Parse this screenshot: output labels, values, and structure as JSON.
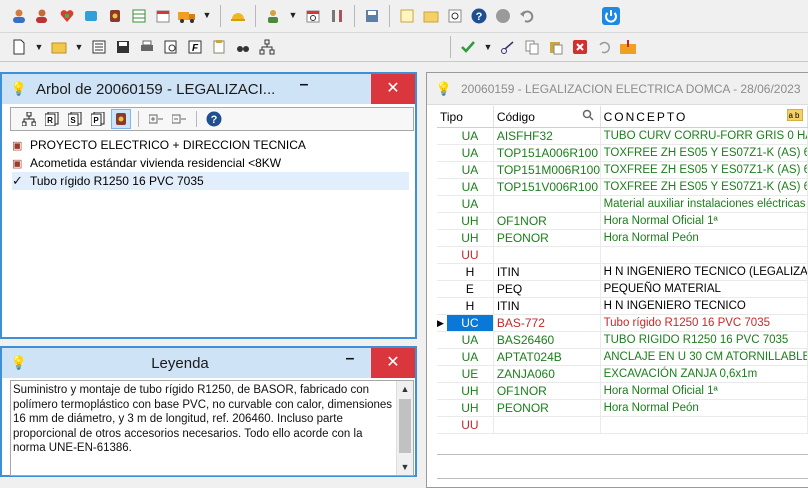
{
  "toolbar1": {
    "icons": [
      "user-icon",
      "user-edit-icon",
      "heart-icon",
      "puzzle-icon",
      "shield-icon",
      "table-icon",
      "calendar-icon",
      "truck-icon",
      "helmet-icon",
      "worker-icon",
      "calendar-clock-icon",
      "tools-icon",
      "save-disk-icon",
      "note-icon",
      "folder-open-icon",
      "clock-refresh-icon",
      "help-icon",
      "stop-icon",
      "undo-icon",
      "power-icon"
    ]
  },
  "toolbar2": {
    "icons": [
      "new-document-icon",
      "open-folder-icon",
      "list-icon",
      "save-icon",
      "print-icon",
      "print-preview-icon",
      "f-icon",
      "clipboard-icon",
      "binoculars-icon",
      "hierarchy-icon",
      "check-icon",
      "cut-icon",
      "copy-icon",
      "paste-icon",
      "delete-icon",
      "redo-icon",
      "export-icon"
    ]
  },
  "tree_panel": {
    "title": "Arbol de 20060159 - LEGALIZACI...",
    "minimize": "–",
    "close": "✕",
    "items": [
      {
        "label": "PROYECTO ELECTRICO + DIRECCION TECNICA",
        "icon": "folder-icon",
        "selected": false
      },
      {
        "label": "Acometida estándar vivienda residencial <8KW",
        "icon": "folder-icon",
        "selected": false
      },
      {
        "label": "Tubo rígido R1250 16 PVC 7035",
        "icon": "check-icon",
        "selected": true
      }
    ]
  },
  "legend_panel": {
    "title": "Leyenda",
    "minimize": "–",
    "close": "✕",
    "text": "Suministro y montaje de tubo rígido R1250, de BASOR, fabricado con polímero termoplástico con base PVC, no curvable con calor, dimensiones 16 mm de diámetro, y 3 m de longitud, ref. 206460. Incluso parte proporcional de otros accesorios necesarios. Todo ello acorde con la norma UNE-EN-61386."
  },
  "grid_panel": {
    "title": "20060159 - LEGALIZACION ELECTRICA DOMCA - 28/06/2023",
    "headers": {
      "tipo": "Tipo",
      "codigo": "Código",
      "concepto": "CONCEPTO"
    },
    "rows": [
      {
        "tipo": "UA",
        "codigo": "AISFHF32",
        "concepto": "TUBO CURV CORRU-FORR GRIS 0 HAL",
        "color": "#1a7f1a",
        "current": false
      },
      {
        "tipo": "UA",
        "codigo": "TOP151A006R100",
        "concepto": "TOXFREE ZH ES05 Y ES07Z1-K (AS) 6 A",
        "color": "#1a7f1a",
        "current": false
      },
      {
        "tipo": "UA",
        "codigo": "TOP151M006R100",
        "concepto": "TOXFREE ZH ES05 Y ES07Z1-K (AS) 6 M",
        "color": "#1a7f1a",
        "current": false
      },
      {
        "tipo": "UA",
        "codigo": "TOP151V006R100",
        "concepto": "TOXFREE ZH ES05 Y ES07Z1-K (AS) 6 A",
        "color": "#1a7f1a",
        "current": false
      },
      {
        "tipo": "UA",
        "codigo": "",
        "concepto": "Material auxiliar instalaciones eléctricas",
        "color": "#1a7f1a",
        "current": false
      },
      {
        "tipo": "UH",
        "codigo": "OF1NOR",
        "concepto": "Hora Normal Oficial 1ª",
        "color": "#1a7f1a",
        "current": false
      },
      {
        "tipo": "UH",
        "codigo": "PEONOR",
        "concepto": "Hora Normal Peón",
        "color": "#1a7f1a",
        "current": false
      },
      {
        "tipo": "UU",
        "codigo": "",
        "concepto": "",
        "color": "#c62828",
        "current": false
      },
      {
        "tipo": "H",
        "codigo": "ITIN",
        "concepto": "H N INGENIERO TECNICO (LEGALIZACI",
        "color": "#000000",
        "current": false
      },
      {
        "tipo": "E",
        "codigo": "PEQ",
        "concepto": "PEQUEÑO MATERIAL",
        "color": "#000000",
        "current": false
      },
      {
        "tipo": "H",
        "codigo": "ITIN",
        "concepto": "H N INGENIERO TECNICO",
        "color": "#000000",
        "current": false
      },
      {
        "tipo": "UC",
        "codigo": "BAS-772",
        "concepto": "Tubo rígido R1250 16 PVC 7035",
        "color": "#c62828",
        "current": true
      },
      {
        "tipo": "UA",
        "codigo": "BAS26460",
        "concepto": "TUBO RIGIDO R1250 16 PVC 7035",
        "color": "#1a7f1a",
        "current": false
      },
      {
        "tipo": "UA",
        "codigo": "APTAT024B",
        "concepto": "ANCLAJE EN U 30 CM ATORNILLABLE (",
        "color": "#1a7f1a",
        "current": false
      },
      {
        "tipo": "UE",
        "codigo": "ZANJA060",
        "concepto": "EXCAVACIÓN ZANJA 0,6x1m",
        "color": "#1a7f1a",
        "current": false
      },
      {
        "tipo": "UH",
        "codigo": "OF1NOR",
        "concepto": "Hora Normal Oficial 1ª",
        "color": "#1a7f1a",
        "current": false
      },
      {
        "tipo": "UH",
        "codigo": "PEONOR",
        "concepto": "Hora Normal Peón",
        "color": "#1a7f1a",
        "current": false
      },
      {
        "tipo": "UU",
        "codigo": "",
        "concepto": "",
        "color": "#c62828",
        "current": false
      }
    ]
  }
}
